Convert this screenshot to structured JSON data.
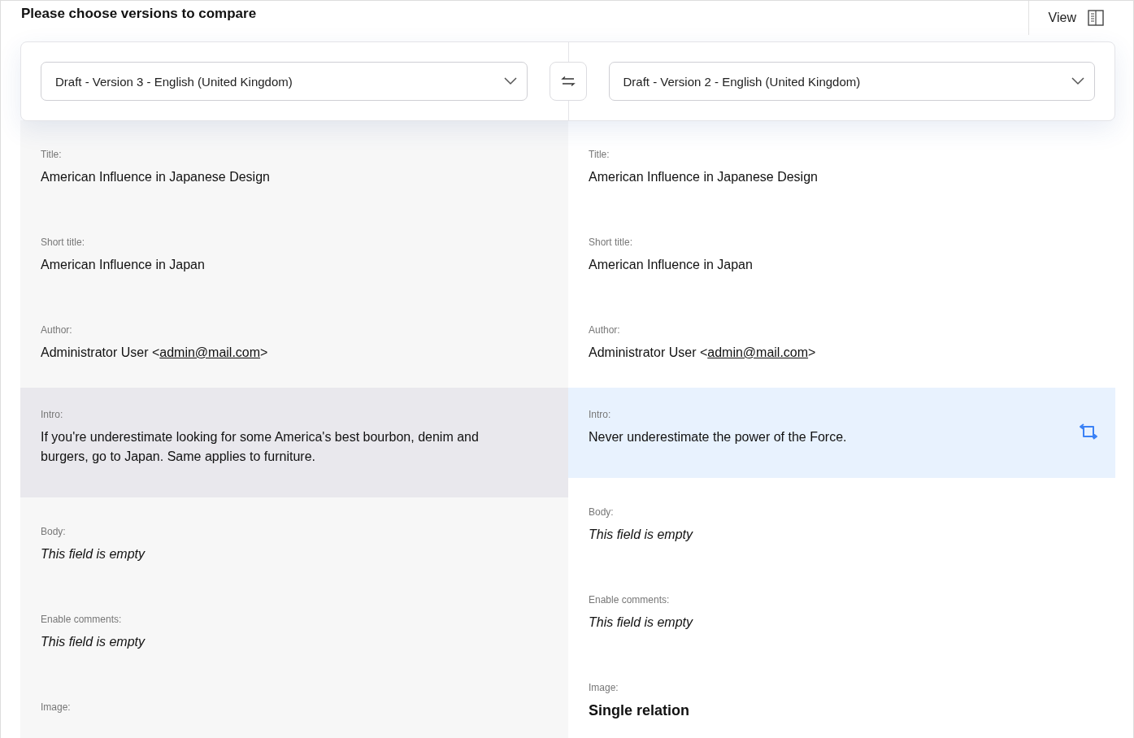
{
  "header": {
    "title": "Please choose versions to compare",
    "view_button": "View"
  },
  "versions": [
    {
      "value": "Draft - Version 3 - English (United Kingdom)"
    },
    {
      "value": "Draft - Version 2 - English (United Kingdom)"
    }
  ],
  "columns": [
    {
      "fields": [
        {
          "label": "Title:",
          "kind": "text",
          "changed": false,
          "value": "American Influence in Japanese Design"
        },
        {
          "label": "Short title:",
          "kind": "text",
          "changed": false,
          "value": "American Influence in Japan"
        },
        {
          "label": "Author:",
          "kind": "email",
          "changed": false,
          "prefix": "Administrator User <",
          "link": "admin@mail.com",
          "suffix": ">"
        },
        {
          "label": "Intro:",
          "kind": "text",
          "changed": true,
          "value": "If you're underestimate looking for some America's best bourbon, denim and burgers, go to Japan. Same applies to furniture."
        },
        {
          "label": "Body:",
          "kind": "empty",
          "changed": false,
          "value": "This field is empty"
        },
        {
          "label": "Enable comments:",
          "kind": "empty",
          "changed": false,
          "value": "This field is empty"
        },
        {
          "label": "Image:",
          "kind": "relation",
          "changed": false
        }
      ]
    },
    {
      "fields": [
        {
          "label": "Title:",
          "kind": "text",
          "changed": false,
          "value": "American Influence in Japanese Design"
        },
        {
          "label": "Short title:",
          "kind": "text",
          "changed": false,
          "value": "American Influence in Japan"
        },
        {
          "label": "Author:",
          "kind": "email",
          "changed": false,
          "prefix": "Administrator User <",
          "link": "admin@mail.com",
          "suffix": ">"
        },
        {
          "label": "Intro:",
          "kind": "text",
          "changed": true,
          "value": "Never underestimate the power of the Force."
        },
        {
          "label": "Body:",
          "kind": "empty",
          "changed": false,
          "value": "This field is empty"
        },
        {
          "label": "Enable comments:",
          "kind": "empty",
          "changed": false,
          "value": "This field is empty"
        },
        {
          "label": "Image:",
          "kind": "relation",
          "changed": false,
          "value": "Single relation"
        }
      ]
    }
  ]
}
